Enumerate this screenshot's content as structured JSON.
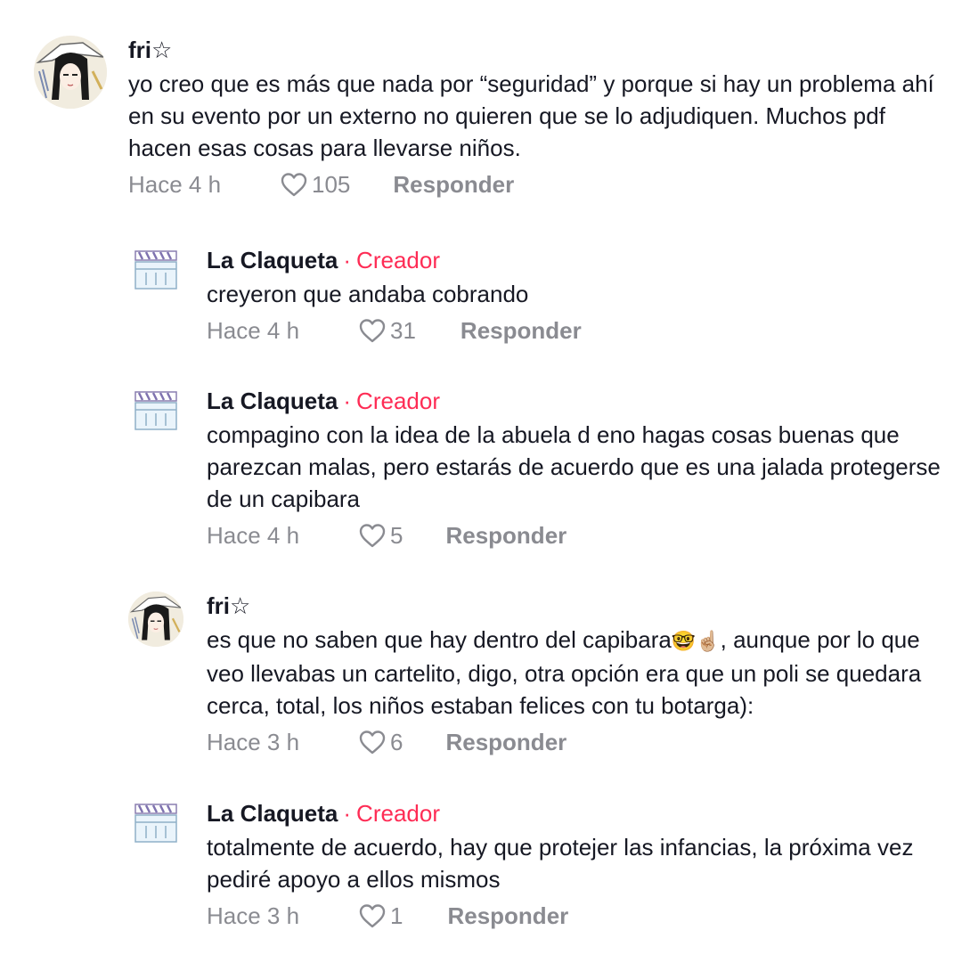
{
  "comments": [
    {
      "author": "fri☆",
      "text": "yo creo que es más que nada por “seguridad” y porque si hay un problema ahí en su evento por un externo no quieren que se lo adjudiquen. Muchos pdf hacen esas cosas para llevarse niños.",
      "time": "Hace 4 h",
      "likes": "105",
      "reply_label": "Responder",
      "avatar_icon": "anime-girl-avatar"
    },
    {
      "author": "La Claqueta",
      "separator": "·",
      "badge": "Creador",
      "text": "creyeron que andaba cobrando",
      "time": "Hace 4 h",
      "likes": "31",
      "reply_label": "Responder",
      "avatar_icon": "clapperboard-avatar"
    },
    {
      "author": "La Claqueta",
      "separator": "·",
      "badge": "Creador",
      "text": "compagino con la idea de la abuela d eno hagas cosas buenas que parezcan malas, pero estarás de acuerdo que es una jalada protegerse de un capibara",
      "time": "Hace 4 h",
      "likes": "5",
      "reply_label": "Responder",
      "avatar_icon": "clapperboard-avatar"
    },
    {
      "author": "fri☆",
      "text_before": "es que no saben que hay dentro del capibara",
      "text_emoji": "🤓☝🏼",
      "text_after": ", aunque por lo que veo llevabas un cartelito, digo, otra opción era que un poli se quedara cerca, total, los niños estaban felices con tu botarga):",
      "time": "Hace 3 h",
      "likes": "6",
      "reply_label": "Responder",
      "avatar_icon": "anime-girl-avatar"
    },
    {
      "author": "La Claqueta",
      "separator": "·",
      "badge": "Creador",
      "text": "totalmente de acuerdo, hay que protejer las infancias, la próxima vez pediré apoyo a ellos mismos",
      "time": "Hace 3 h",
      "likes": "1",
      "reply_label": "Responder",
      "avatar_icon": "clapperboard-avatar"
    }
  ],
  "colors": {
    "creator_badge": "#fe2c55",
    "meta_text": "#8a8b91",
    "body_text": "#161823"
  }
}
